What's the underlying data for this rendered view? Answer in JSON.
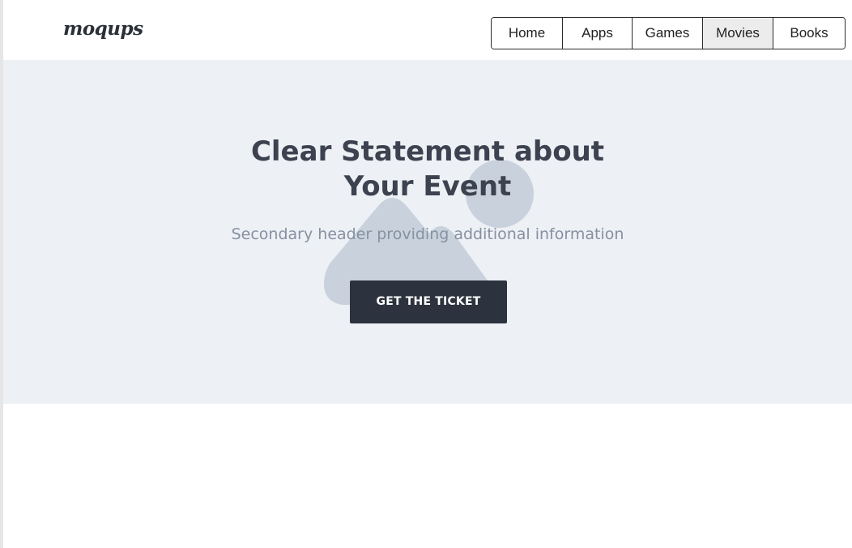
{
  "header": {
    "logo_text": "moqups",
    "nav": [
      {
        "label": "Home",
        "active": false
      },
      {
        "label": "Apps",
        "active": false
      },
      {
        "label": "Games",
        "active": false
      },
      {
        "label": "Movies",
        "active": true
      },
      {
        "label": "Books",
        "active": false
      }
    ]
  },
  "hero": {
    "title_line1": "Clear Statement about",
    "title_line2": "Your Event",
    "subtitle": "Secondary header providing additional information",
    "cta_label": "GET THE TICKET",
    "placeholder_icon": "image-placeholder-icon"
  },
  "colors": {
    "hero_background": "#edf0f4",
    "placeholder_shape": "#c9d2dc",
    "title": "#3d4250",
    "subtitle": "#8591a3",
    "button_background": "#2d333e",
    "button_text": "#ffffff",
    "active_nav": "#ececec"
  }
}
